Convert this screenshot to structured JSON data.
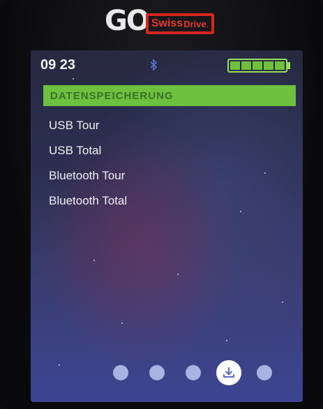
{
  "brand": {
    "go": "GO",
    "swiss": "Swiss",
    "drive": "Drive",
    "dot": "."
  },
  "status": {
    "time": "09 23",
    "battery_cells": 5,
    "battery_level": 1.0
  },
  "header": {
    "title": "DATENSPEICHERUNG"
  },
  "menu": {
    "items": [
      {
        "label": "USB Tour"
      },
      {
        "label": "USB Total"
      },
      {
        "label": "Bluetooth Tour"
      },
      {
        "label": "Bluetooth Total"
      }
    ]
  },
  "pager": {
    "count": 5,
    "active_index": 3,
    "active_icon": "download-icon"
  },
  "colors": {
    "header_bg": "#6cc13f",
    "header_text": "#3e6e27",
    "battery": "#6fc23a",
    "brand_red": "#e63a2b"
  }
}
